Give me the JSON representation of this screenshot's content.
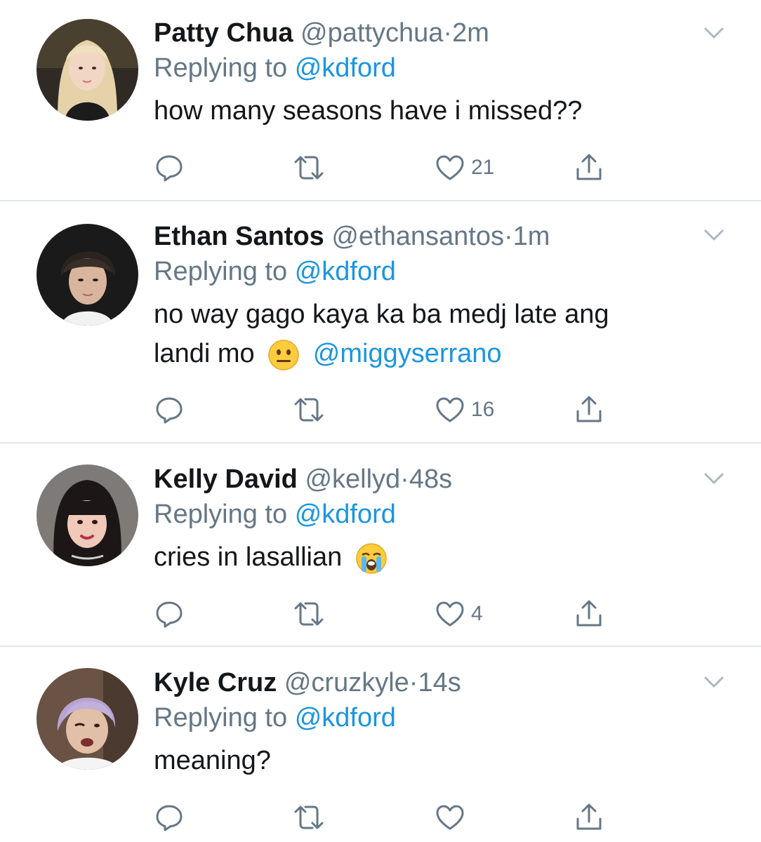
{
  "replies": [
    {
      "name": "Patty Chua",
      "handle": "@pattychua",
      "separator": "·",
      "time": "2m",
      "replying_prefix": "Replying to",
      "replying_to": "@kdford",
      "text": "how many seasons have i missed??",
      "likes": "21",
      "avatar": "avatar-blonde-woman"
    },
    {
      "name": "Ethan Santos",
      "handle": "@ethansantos",
      "separator": "·",
      "time": "1m",
      "replying_prefix": "Replying to",
      "replying_to": "@kdford",
      "text_line1": "no way gago kaya ka ba medj late ang",
      "text_line2": "landi mo",
      "emoji": "neutral-face-emoji",
      "mention": "@miggyserrano",
      "likes": "16",
      "avatar": "avatar-dark-hair-man"
    },
    {
      "name": "Kelly David",
      "handle": "@kellyd",
      "separator": "·",
      "time": "48s",
      "replying_prefix": "Replying to",
      "replying_to": "@kdford",
      "text": "cries in lasallian",
      "emoji": "loudly-crying-face-emoji",
      "likes": "4",
      "avatar": "avatar-bangs-woman"
    },
    {
      "name": "Kyle Cruz",
      "handle": "@cruzkyle",
      "separator": "·",
      "time": "14s",
      "replying_prefix": "Replying to",
      "replying_to": "@kdford",
      "text": "meaning?",
      "likes": "",
      "avatar": "avatar-lilac-hair-man"
    }
  ],
  "colors": {
    "name": "#14171a",
    "secondary": "#657786",
    "link": "#1b95e0",
    "divider": "#e1e8ed"
  }
}
